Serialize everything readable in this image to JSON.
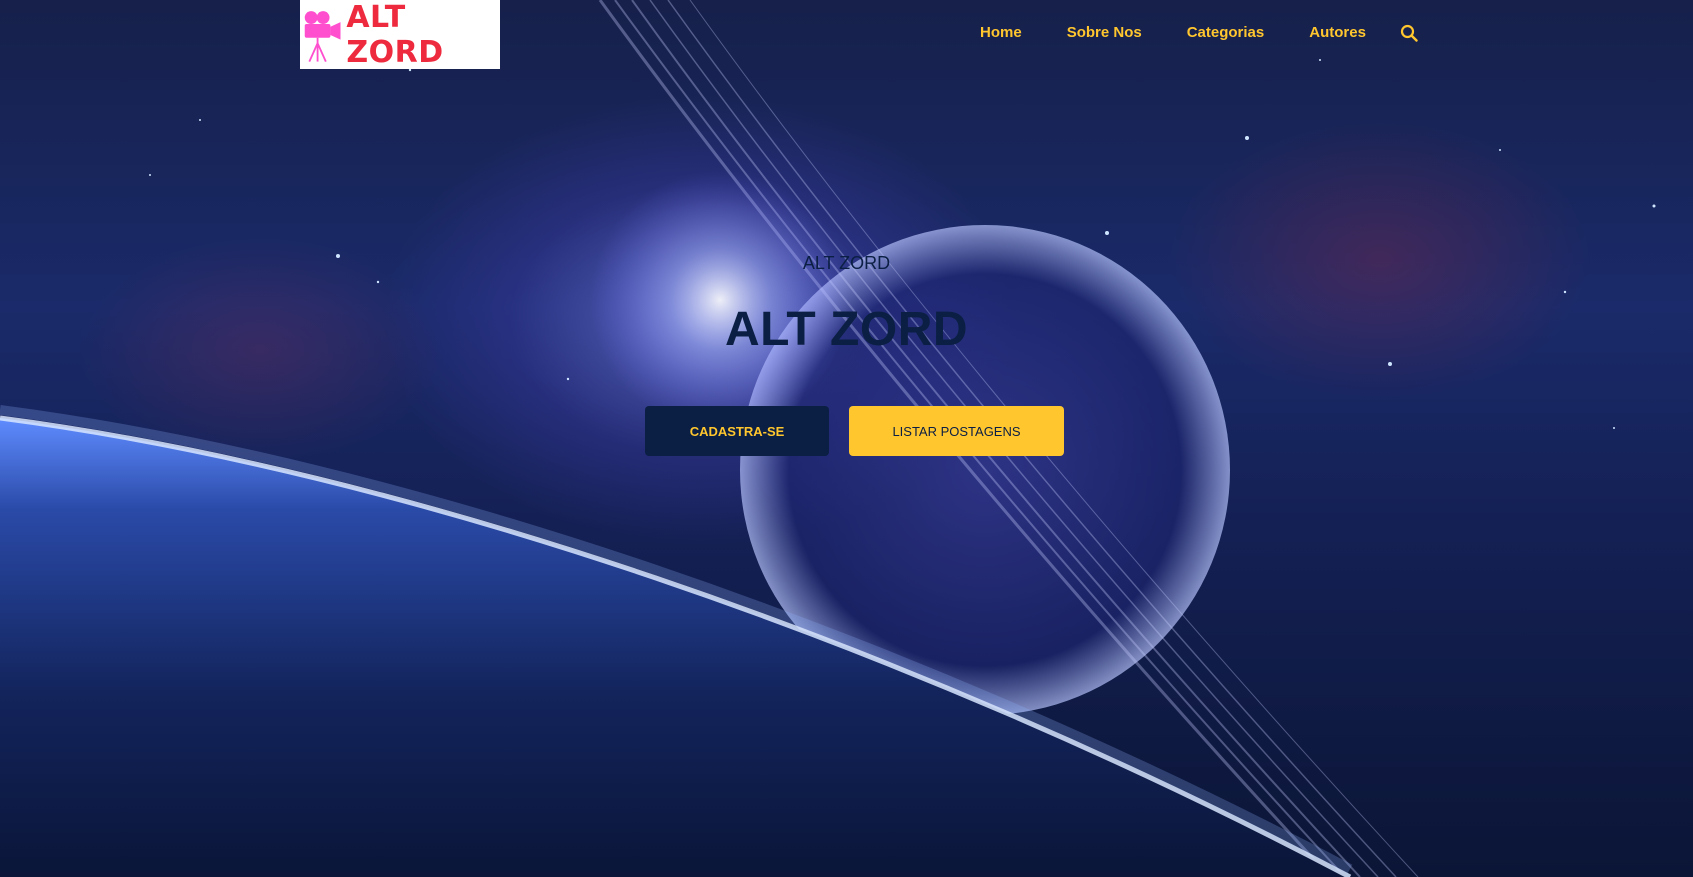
{
  "brand": {
    "logo_text": "ALT ZORD",
    "logo_icon": "movie-camera-icon"
  },
  "nav": {
    "items": [
      {
        "label": "Home"
      },
      {
        "label": "Sobre Nos"
      },
      {
        "label": "Categorias"
      },
      {
        "label": "Autores"
      }
    ],
    "search_icon": "search-icon"
  },
  "hero": {
    "subtitle": "ALT ZORD",
    "title": "ALT ZORD",
    "buttons": {
      "register_label": "CADASTRA-SE",
      "list_posts_label": "LISTAR POSTAGENS"
    }
  },
  "colors": {
    "accent": "#ffc62e",
    "navy": "#0b1f44",
    "logo_red": "#ee2a3e",
    "camera_pink": "#ff4fcf"
  }
}
